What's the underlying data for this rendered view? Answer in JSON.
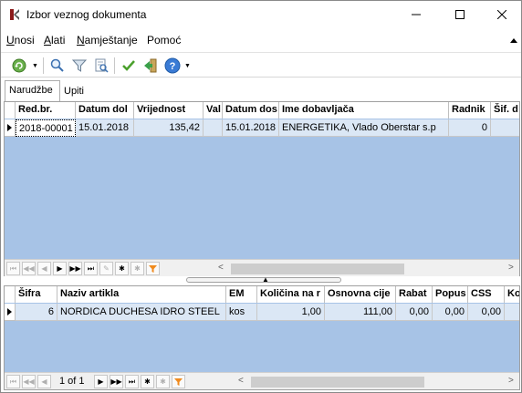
{
  "window": {
    "title": "Izbor veznog dokumenta",
    "controls": {
      "minimize": "minimize",
      "maximize": "maximize",
      "close": "close"
    }
  },
  "menu": {
    "items": [
      {
        "label": "Unosi",
        "underline": "U",
        "rest": "nosi"
      },
      {
        "label": "Alati",
        "underline": "A",
        "rest": "lati"
      },
      {
        "label": "Namještanje",
        "underline": "N",
        "rest": "amještanje"
      },
      {
        "label": "Pomoć",
        "underline": "",
        "rest": "Pomoć"
      }
    ]
  },
  "toolbar": {
    "icons": [
      "refresh-icon",
      "search-icon",
      "filter-icon",
      "find-in-list-icon",
      "confirm-check-icon",
      "exit-icon",
      "help-icon"
    ]
  },
  "tabs": [
    {
      "label": "Narudžbe",
      "active": true
    },
    {
      "label": "Upiti",
      "active": false
    }
  ],
  "orders_grid": {
    "columns": [
      "Red.br.",
      "Datum dol",
      "Vrijednost",
      "Val",
      "Datum dos",
      "Ime dobavljača",
      "Radnik",
      "Šif. d"
    ],
    "rows": [
      [
        "2018-00001",
        "15.01.2018",
        "135,42",
        "",
        "15.01.2018",
        "ENERGETIKA, Vlado Oberstar s.p",
        "0",
        ""
      ]
    ]
  },
  "items_grid": {
    "columns": [
      "Šifra",
      "Naziv artikla",
      "EM",
      "Količina na r",
      "Osnovna cije",
      "Rabat",
      "Popus",
      "CSS",
      "Ko"
    ],
    "rows": [
      [
        "6",
        "NORDICA DUCHESA IDRO STEEL",
        "kos",
        "1,00",
        "111,00",
        "0,00",
        "0,00",
        "0,00",
        ""
      ]
    ],
    "record_info": "1 of 1"
  },
  "colors": {
    "grid_background": "#a7c3e6",
    "row_background": "#dbe7f5",
    "window_border": "#8a8a8a"
  }
}
